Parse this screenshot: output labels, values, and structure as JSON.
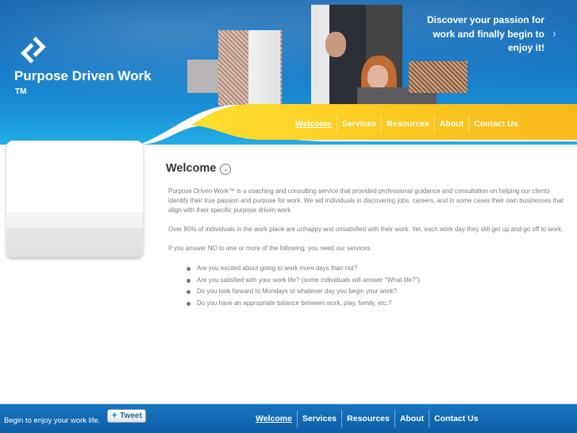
{
  "header": {
    "site_title": "Purpose Driven Work",
    "trademark": "TM",
    "tagline": "Discover your passion for work and finally begin to enjoy it!",
    "tagline_arrow": "›"
  },
  "nav": [
    {
      "label": "Welcome",
      "active": true
    },
    {
      "label": "Services"
    },
    {
      "label": "Resources"
    },
    {
      "label": "About"
    },
    {
      "label": "Contact Us"
    }
  ],
  "main": {
    "title": "Welcome",
    "title_toggle": "⌄",
    "paragraphs": [
      "Purpose Driven Work™ is a coaching and consulting service that provided professional guidance and consultation on helping our clients identify their true passion and purpose for work.  We aid individuals in discovering jobs, careers, and in some cases their own businesses that align with their specific purpose driven work.",
      "Over 80% of individuals in the work place are unhappy and unsatisfied with their work.  Yet, each work day they still get up and go off to work.",
      "If you answer NO to one or more of the following, you need our services."
    ],
    "bullets": [
      "Are you excited about going to work more days than not?",
      "Are you satisfied with your work life?  (some individuals will answer \"What life?\")",
      "Do you look forward to Mondays or whatever day you begin your work?",
      "Do you have an appropriate balance between work, play, family, etc.?"
    ]
  },
  "footer": {
    "text": "Begin to enjoy your work life.",
    "tweet_label": "Tweet",
    "tweet_icon": "twitter-bird"
  },
  "colors": {
    "blue": "#1577c4",
    "yellow": "#fbc21f"
  }
}
